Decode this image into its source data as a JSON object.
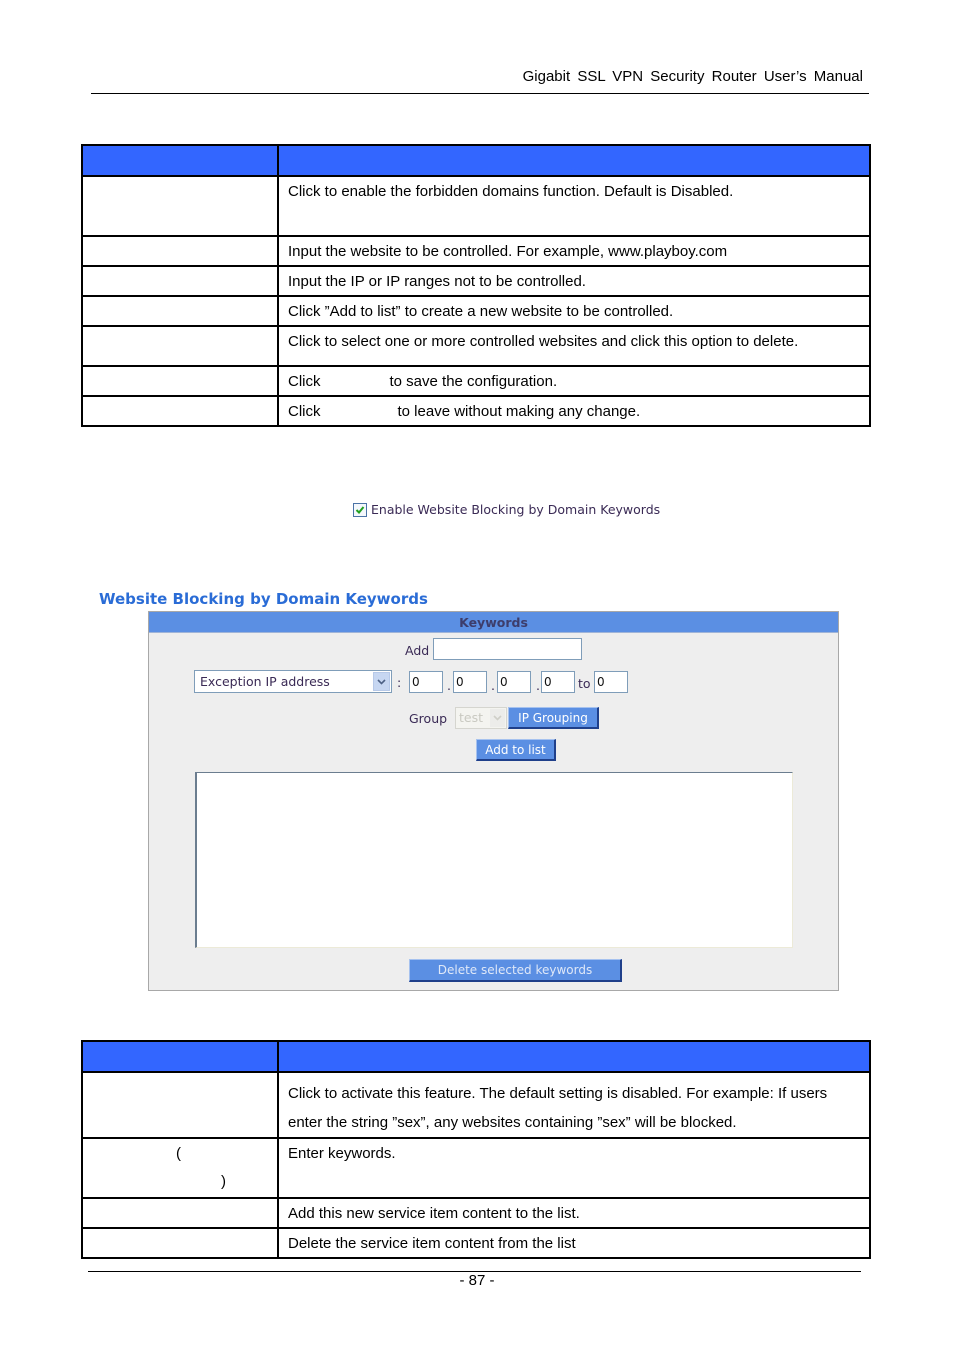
{
  "header": {
    "title": "Gigabit  SSL  VPN  Security  Router  User’s  Manual"
  },
  "table1": {
    "rows": [
      {
        "name": "",
        "desc": "Click to enable the forbidden domains function.    Default is Disabled."
      },
      {
        "name": "",
        "desc": "Input the website to be controlled. For example, www.playboy.com"
      },
      {
        "name": "",
        "desc": "Input the IP or IP ranges not to be controlled."
      },
      {
        "name": "",
        "desc": "Click ”Add to list” to create a new website to be controlled."
      },
      {
        "name": "",
        "desc": "Click to select one or more controlled websites and click this option to delete."
      },
      {
        "name": "",
        "desc_prefix": "Click",
        "desc": "to save the configuration."
      },
      {
        "name": "",
        "desc_prefix": "Click",
        "desc": "to leave without making any change."
      }
    ]
  },
  "screenshot1": {
    "enable_checkbox": {
      "label": "Enable Website Blocking by Domain Keywords",
      "checked": true
    }
  },
  "screenshot2": {
    "section_title": "Website Blocking by Domain Keywords",
    "panel_header": "Keywords",
    "add_label": "Add",
    "add_value": "",
    "ip_type_select": "Exception IP address",
    "ip_octets": [
      "0",
      "0",
      "0",
      "0"
    ],
    "to_label": "to",
    "to_value": "0",
    "colon": ":",
    "dot": ".",
    "group_label": "Group",
    "group_select": "test",
    "ip_grouping_button": "IP Grouping",
    "add_to_list_button": "Add to list",
    "keyword_list": [],
    "delete_button": "Delete selected keywords"
  },
  "table2": {
    "rows": [
      {
        "name": "",
        "desc_line1": "Click to activate this feature. The default setting is disabled. For example: If users",
        "desc_line2": "enter the string ”sex”, any websites containing ”sex” will be blocked."
      },
      {
        "name_open": "(",
        "name_close": ")",
        "desc": "Enter keywords."
      },
      {
        "name": "",
        "desc": "Add this new service item content to the list."
      },
      {
        "name": "",
        "desc": "Delete the service item content from the list"
      }
    ]
  },
  "footer": {
    "page_number": "- 87 -"
  },
  "colors": {
    "table_header": "#3366ff",
    "panel_header": "#5b8fe3",
    "button": "#5b8fe3",
    "section_title": "#2a6cd6"
  }
}
